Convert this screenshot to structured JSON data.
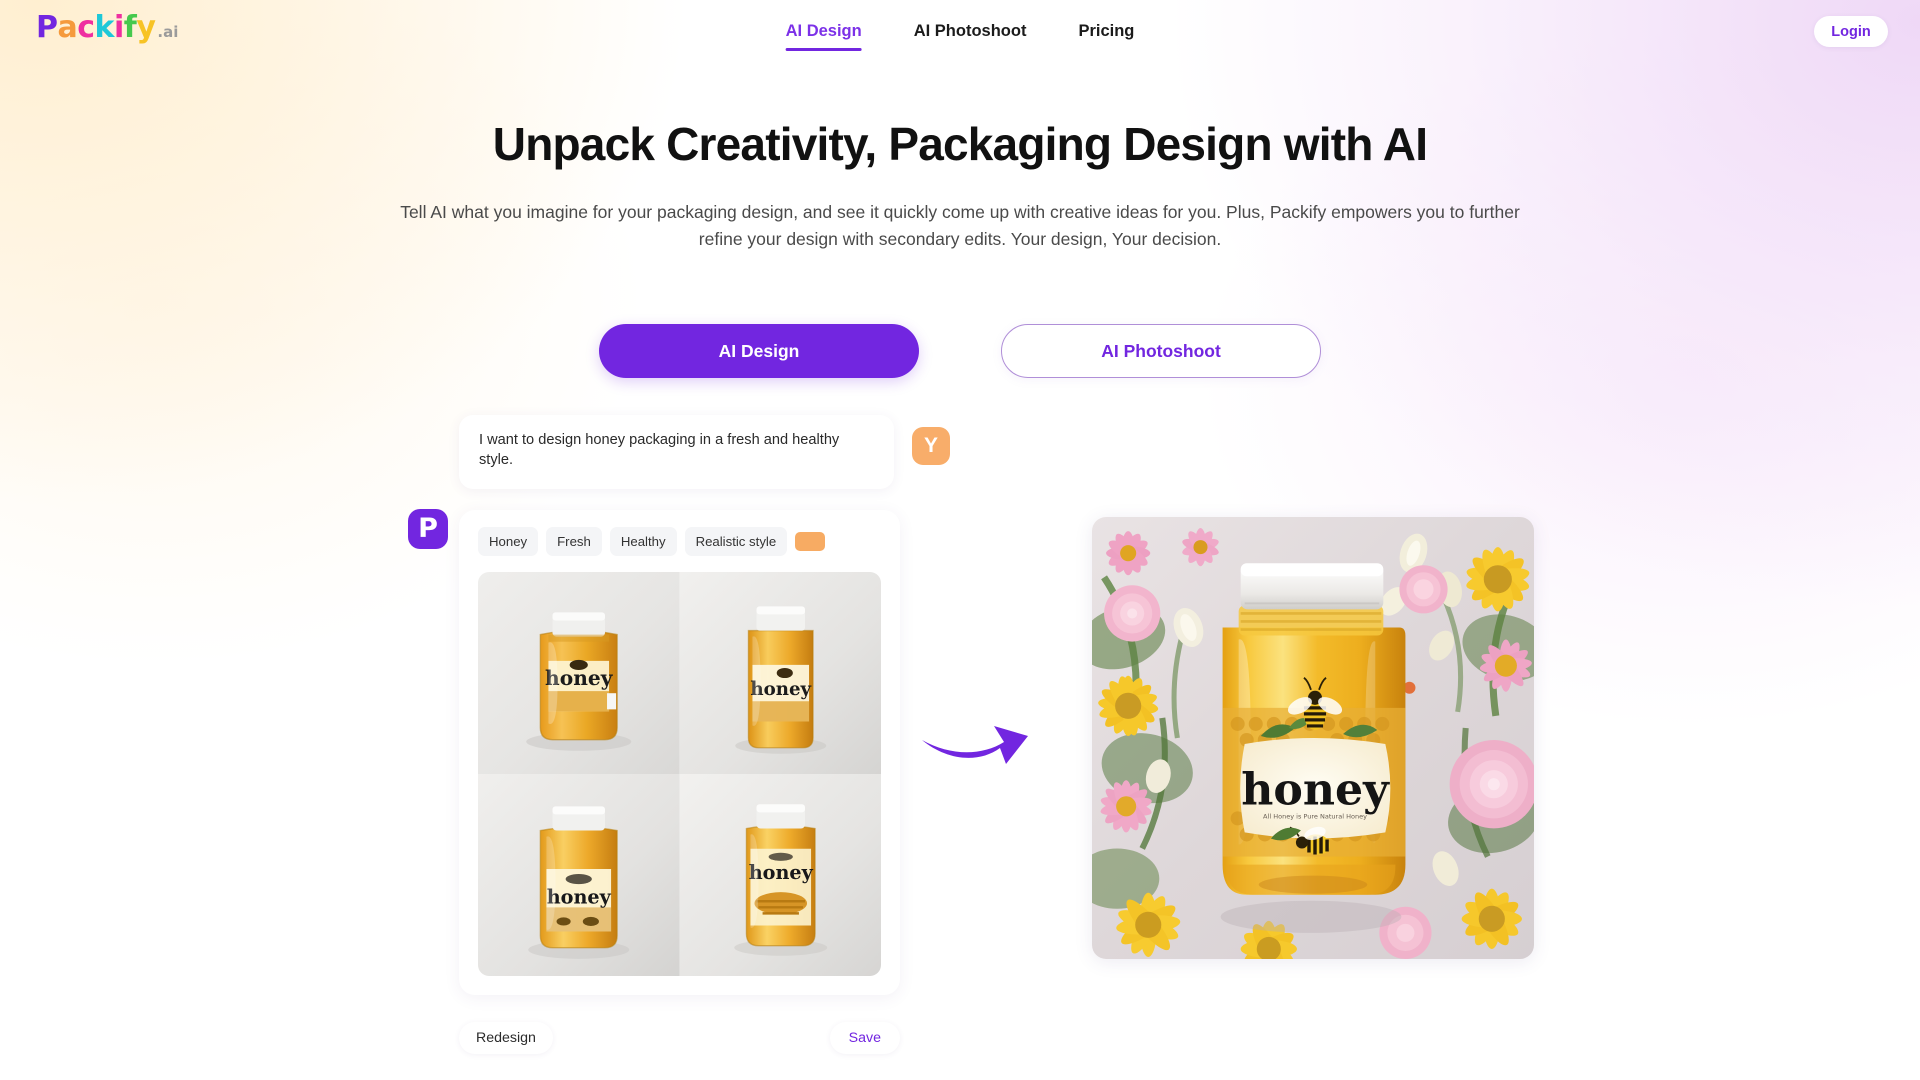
{
  "brand": {
    "logo_letters": [
      {
        "ch": "P",
        "color": "#7226e0"
      },
      {
        "ch": "a",
        "color": "#f59a3c"
      },
      {
        "ch": "c",
        "color": "#ef2fa0"
      },
      {
        "ch": "k",
        "color": "#1ec8d8"
      },
      {
        "ch": "i",
        "color": "#ef2fa0"
      },
      {
        "ch": "f",
        "color": "#46c94e"
      },
      {
        "ch": "y",
        "color": "#f7c325"
      }
    ],
    "logo_suffix": ".ai",
    "accent": "#7226e0",
    "accent_orange": "#f7ab63"
  },
  "nav": {
    "items": [
      {
        "label": "AI Design",
        "active": true
      },
      {
        "label": "AI Photoshoot",
        "active": false
      },
      {
        "label": "Pricing",
        "active": false
      }
    ],
    "login_label": "Login"
  },
  "hero": {
    "title": "Unpack Creativity, Packaging Design with AI",
    "subtitle": "Tell AI what you imagine for your packaging design, and see it quickly come up with creative ideas for you. Plus, Packify empowers you to further refine your design with secondary edits. Your design, Your decision."
  },
  "cta": {
    "primary_label": "AI Design",
    "secondary_label": "AI Photoshoot"
  },
  "demo": {
    "user_prompt": "I want to design honey packaging in a fresh and healthy style.",
    "user_avatar_initial": "Y",
    "bot_avatar_initial": "P",
    "tags": [
      "Honey",
      "Fresh",
      "Healthy",
      "Realistic style"
    ],
    "color_swatch": "#f7ab63",
    "thumbnails": [
      {
        "label": "honey"
      },
      {
        "label": "honey"
      },
      {
        "label": "honey"
      },
      {
        "label": "honey"
      }
    ],
    "final_label": "honey",
    "final_sublabel": "All Honey is Pure Natural Honey",
    "redesign_label": "Redesign",
    "save_label": "Save"
  }
}
